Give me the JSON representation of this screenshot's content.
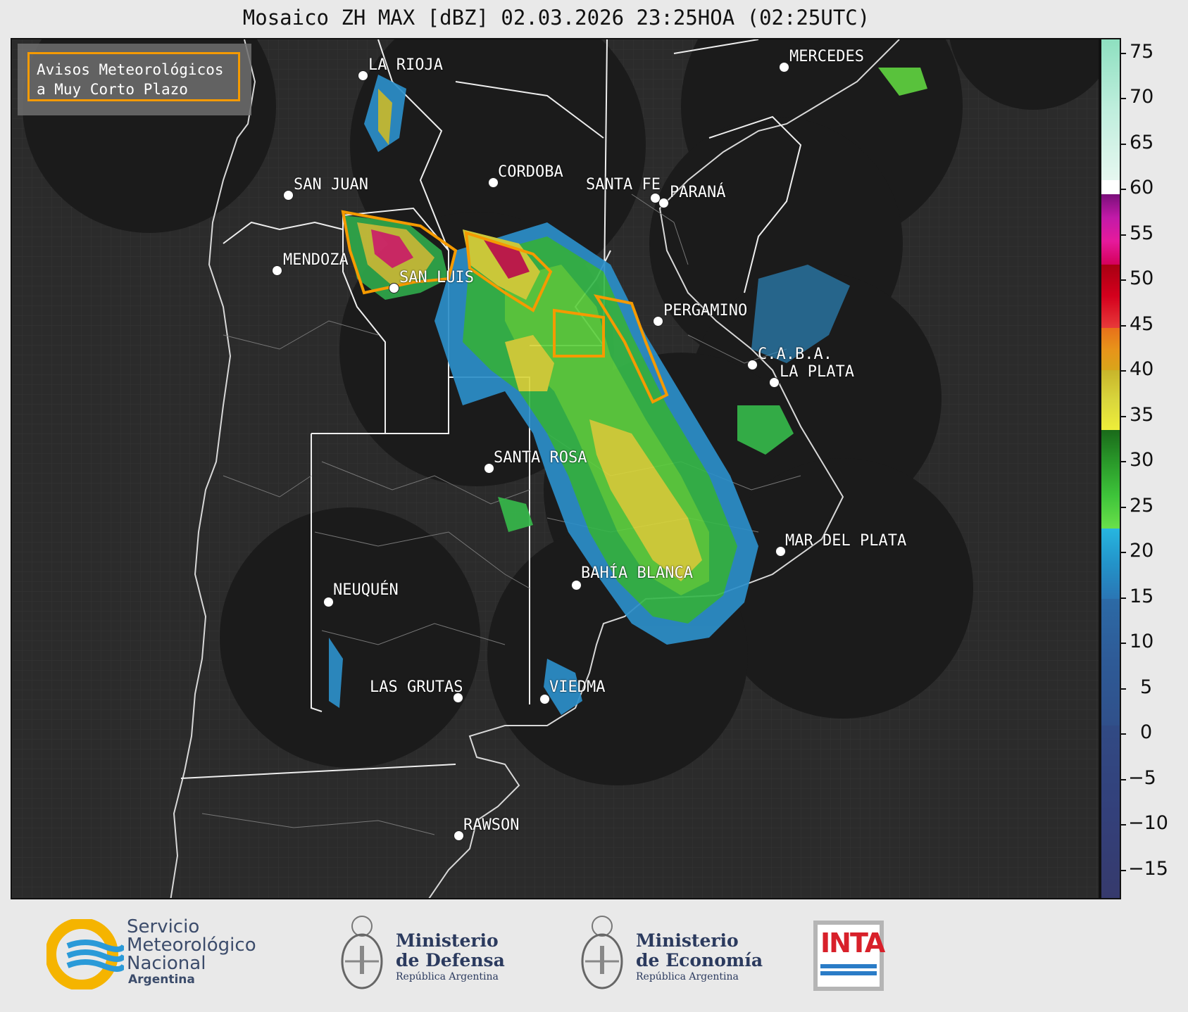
{
  "title": "Mosaico ZH MAX [dBZ] 02.03.2026 23:25HOA (02:25UTC)",
  "warning_legend": {
    "line1": "Avisos Meteorológicos",
    "line2": "a Muy Corto Plazo",
    "color": "#f59a00"
  },
  "cities": [
    {
      "name": "LA RIOJA"
    },
    {
      "name": "MERCEDES"
    },
    {
      "name": "CORDOBA"
    },
    {
      "name": "SAN JUAN"
    },
    {
      "name": "SANTA FE"
    },
    {
      "name": "PARANÁ"
    },
    {
      "name": "MENDOZA"
    },
    {
      "name": "SAN LUIS"
    },
    {
      "name": "PERGAMINO"
    },
    {
      "name": "C.A.B.A."
    },
    {
      "name": "LA PLATA"
    },
    {
      "name": "SANTA ROSA"
    },
    {
      "name": "MAR DEL PLATA"
    },
    {
      "name": "BAHÍA BLANCA"
    },
    {
      "name": "NEUQUÉN"
    },
    {
      "name": "LAS GRUTAS"
    },
    {
      "name": "VIEDMA"
    },
    {
      "name": "RAWSON"
    }
  ],
  "colorbar": {
    "unit": "dBZ",
    "ticks": [
      "75",
      "70",
      "65",
      "60",
      "55",
      "50",
      "45",
      "40",
      "35",
      "30",
      "25",
      "20",
      "15",
      "10",
      "5",
      "0",
      "−5",
      "−10",
      "−15"
    ],
    "colors": {
      "high_green": "#7fd8b4",
      "white": "#ffffff",
      "magenta": "#c21aa8",
      "red": "#d4001d",
      "orange": "#e8831a",
      "yellow": "#e6e63a",
      "green": "#2fbf2a",
      "cyan": "#27a6d9",
      "blue": "#2c5b9c",
      "navy": "#2e3a72"
    }
  },
  "logos": {
    "smn": {
      "line1": "Servicio",
      "line2": "Meteorológico",
      "line3": "Nacional",
      "line4": "Argentina"
    },
    "defensa": {
      "line1": "Ministerio",
      "line2": "de Defensa",
      "line3": "República Argentina"
    },
    "economia": {
      "line1": "Ministerio",
      "line2": "de Economía",
      "line3": "República Argentina"
    },
    "inta": {
      "label": "INTA"
    }
  }
}
